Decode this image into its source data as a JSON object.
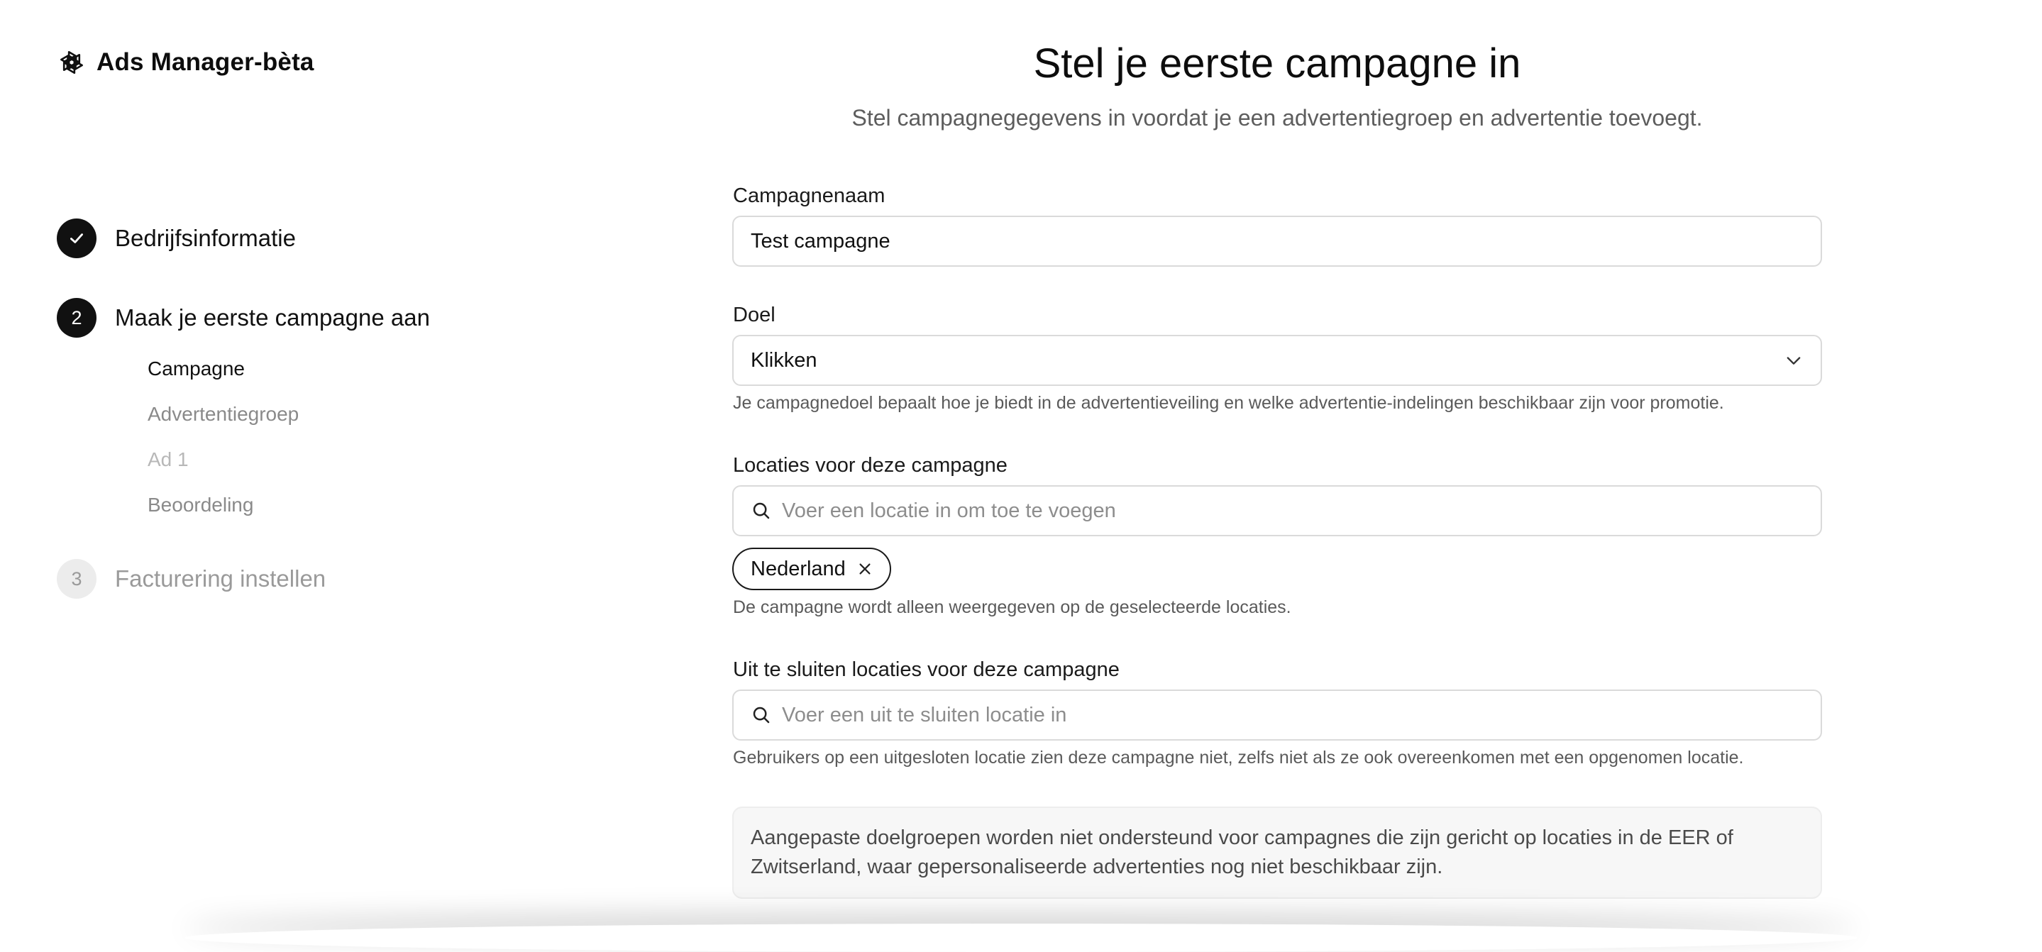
{
  "brand": {
    "title": "Ads Manager-bèta",
    "logo_icon": "openai-logo-icon"
  },
  "stepper": {
    "steps": [
      {
        "number": "✓",
        "label": "Bedrijfsinformatie",
        "state": "done"
      },
      {
        "number": "2",
        "label": "Maak je eerste campagne aan",
        "state": "active"
      },
      {
        "number": "3",
        "label": "Facturering instellen",
        "state": "pending"
      }
    ],
    "substeps": [
      {
        "label": "Campagne",
        "state": "current"
      },
      {
        "label": "Advertentiegroep",
        "state": "upcoming"
      },
      {
        "label": "Ad 1",
        "state": "disabled"
      },
      {
        "label": "Beoordeling",
        "state": "upcoming"
      }
    ]
  },
  "header": {
    "title": "Stel je eerste campagne in",
    "subtitle": "Stel campagnegegevens in voordat je een advertentiegroep en advertentie toevoegt."
  },
  "form": {
    "campaign_name": {
      "label": "Campagnenaam",
      "value": "Test campagne"
    },
    "goal": {
      "label": "Doel",
      "selected": "Klikken",
      "help": "Je campagnedoel bepaalt hoe je biedt in de advertentieveiling en welke advertentie-indelingen beschikbaar zijn voor promotie."
    },
    "locations": {
      "label": "Locaties voor deze campagne",
      "placeholder": "Voer een locatie in om toe te voegen",
      "chips": [
        "Nederland"
      ],
      "help": "De campagne wordt alleen weergegeven op de geselecteerde locaties."
    },
    "excluded_locations": {
      "label": "Uit te sluiten locaties voor deze campagne",
      "placeholder": "Voer een uit te sluiten locatie in",
      "help": "Gebruikers op een uitgesloten locatie zien deze campagne niet, zelfs niet als ze ook overeenkomen met een opgenomen locatie."
    },
    "notice": "Aangepaste doelgroepen worden niet ondersteund voor campagnes die zijn gericht op locaties in de EER of Zwitserland, waar gepersonaliseerde advertenties nog niet beschikbaar zijn."
  },
  "icons": {
    "check": "check-icon",
    "search": "search-icon",
    "chevron": "chevron-down-icon",
    "remove": "close-icon"
  },
  "colors": {
    "primary": "#111111",
    "muted": "#9a9a9a",
    "border": "#dadada",
    "notice_bg": "#f7f7f7"
  }
}
